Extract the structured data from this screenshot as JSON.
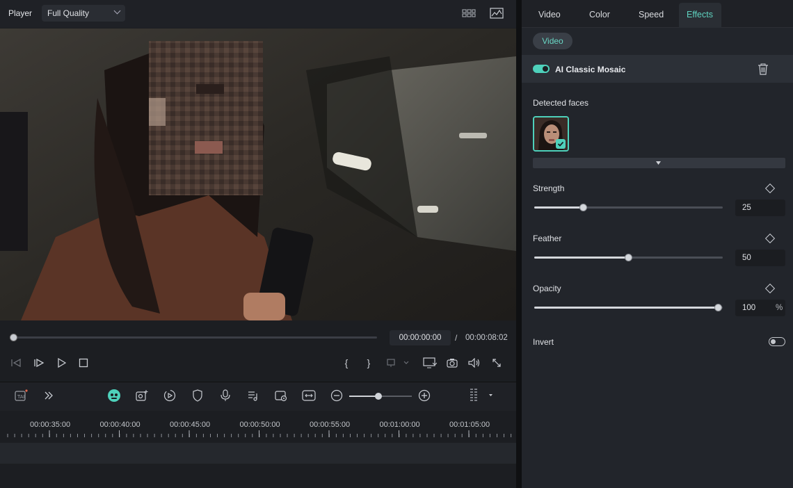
{
  "player": {
    "label": "Player",
    "quality": "Full Quality",
    "current_time": "00:00:00:00",
    "separator": "/",
    "total_time": "00:00:08:02",
    "progress": 0
  },
  "timeline": {
    "ruler_labels": [
      "00:00:35:00",
      "00:00:40:00",
      "00:00:45:00",
      "00:00:50:00",
      "00:00:55:00",
      "00:01:00:00",
      "00:01:05:00"
    ],
    "zoom_level": 0.45
  },
  "properties": {
    "tabs": [
      "Video",
      "Color",
      "Speed",
      "Effects"
    ],
    "active_tab": "Effects",
    "sub_pill": "Video",
    "effect": {
      "name": "AI Classic Mosaic",
      "enabled": true
    },
    "detected_faces_label": "Detected faces",
    "strength": {
      "label": "Strength",
      "value": "25",
      "fraction": 0.25
    },
    "feather": {
      "label": "Feather",
      "value": "50",
      "fraction": 0.5
    },
    "opacity": {
      "label": "Opacity",
      "value": "100",
      "unit": "%",
      "fraction": 1.0
    },
    "invert": {
      "label": "Invert",
      "enabled": false
    }
  },
  "colors": {
    "accent": "#4ed1bb",
    "panel": "#22252b",
    "background": "#1c1e22"
  },
  "icons": {
    "player_header": [
      "grid-view-icon",
      "waveform-chart-icon"
    ],
    "transport": [
      "prev-frame-icon",
      "play-frame-icon",
      "play-icon",
      "stop-icon",
      "mark-in-icon",
      "mark-out-icon",
      "insert-icon",
      "monitor-icon",
      "snapshot-icon",
      "volume-icon",
      "fullscreen-icon"
    ],
    "timeline_toolbar": [
      "ai-text-icon",
      "expand-icon",
      "ai-face-icon",
      "add-media-icon",
      "auto-reframe-icon",
      "shield-icon",
      "microphone-icon",
      "music-list-icon",
      "video-preview-icon",
      "fit-width-icon",
      "zoom-out-icon",
      "zoom-in-icon",
      "layout-grid-icon"
    ]
  }
}
